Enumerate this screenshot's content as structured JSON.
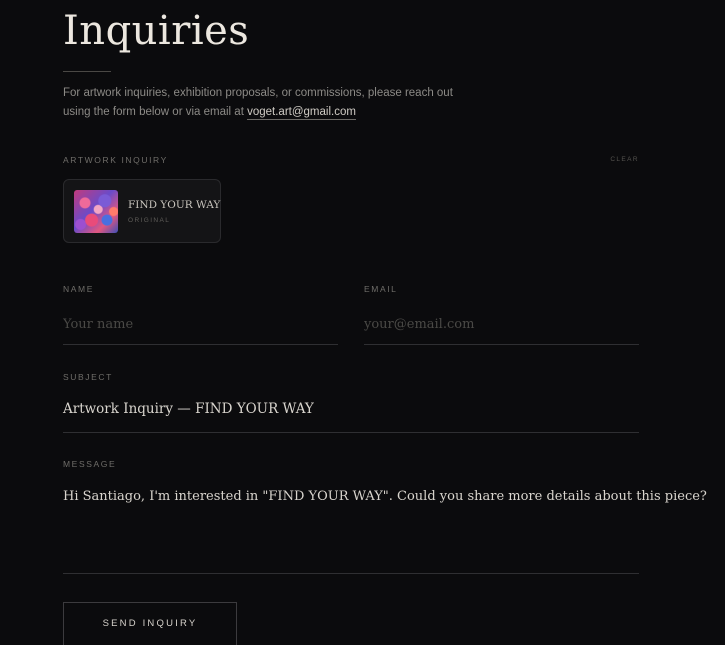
{
  "page": {
    "title": "Inquiries",
    "intro_text": "For artwork inquiries, exhibition proposals, or commissions, please reach out using the form below or via email at ",
    "email_link": "voget.art@gmail.com"
  },
  "artwork_section": {
    "label": "ARTWORK INQUIRY",
    "clear_label": "CLEAR",
    "artwork": {
      "title": "FIND YOUR WAY",
      "subtitle": "ORIGINAL"
    }
  },
  "form": {
    "name": {
      "label": "NAME",
      "placeholder": "Your name",
      "value": ""
    },
    "email": {
      "label": "EMAIL",
      "placeholder": "your@email.com",
      "value": ""
    },
    "subject": {
      "label": "SUBJECT",
      "value": "Artwork Inquiry — FIND YOUR WAY"
    },
    "message": {
      "label": "MESSAGE",
      "value": "Hi Santiago, I'm interested in \"FIND YOUR WAY\". Could you share more details about this piece?"
    },
    "submit_label": "SEND INQUIRY"
  },
  "colors": {
    "background": "#0b0b0d",
    "text": "#e7e3dc",
    "muted": "#8c8a86",
    "border": "#2f2f32"
  }
}
